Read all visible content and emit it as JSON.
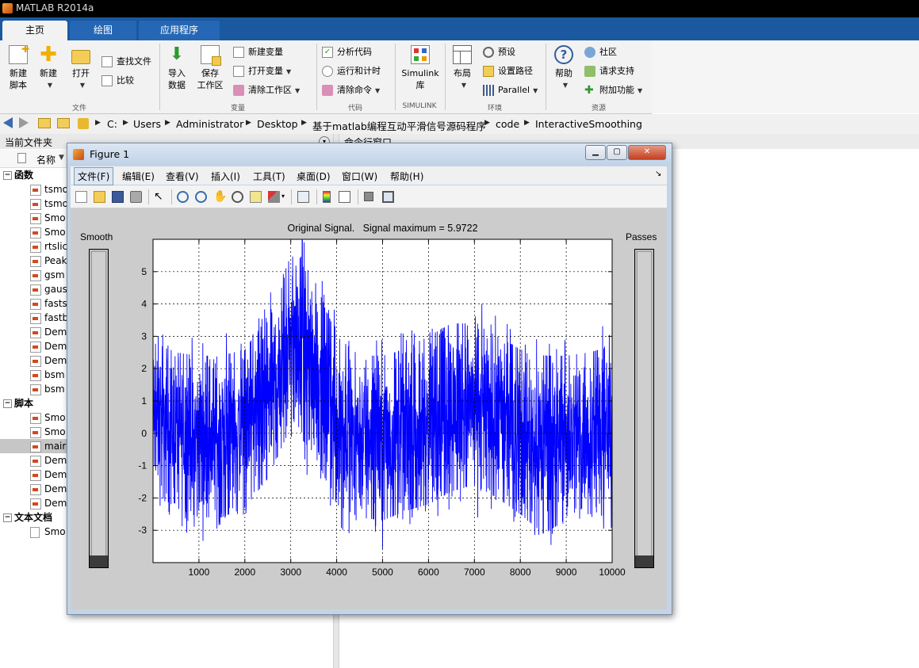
{
  "app": {
    "title": "MATLAB R2014a"
  },
  "tabs": [
    "主页",
    "绘图",
    "应用程序"
  ],
  "ribbon": {
    "groups": {
      "file": "文件",
      "variable": "变量",
      "code": "代码",
      "simulink": "SIMULINK",
      "environment": "环境",
      "resources": "资源"
    },
    "new_script": [
      "新建",
      "脚本"
    ],
    "new": "新建",
    "open": "打开",
    "find_files": "查找文件",
    "compare": "比较",
    "import_data": [
      "导入",
      "数据"
    ],
    "save_workspace": [
      "保存",
      "工作区"
    ],
    "new_variable": "新建变量",
    "open_variable": "打开变量",
    "clear_workspace": "清除工作区",
    "analyze_code": "分析代码",
    "run_and_time": "运行和计时",
    "clear_commands": "清除命令",
    "simulink": [
      "Simulink",
      "库"
    ],
    "layout": "布局",
    "preferences": "预设",
    "set_path": "设置路径",
    "parallel": "Parallel",
    "help": "帮助",
    "community": "社区",
    "request_support": "请求支持",
    "addons": "附加功能"
  },
  "address": {
    "path": [
      "C:",
      "Users",
      "Administrator",
      "Desktop",
      "基于matlab编程互动平滑信号源码程序",
      "code",
      "InteractiveSmoothing"
    ]
  },
  "left_panel": {
    "title": "当前文件夹",
    "name_col": "名称",
    "sections": [
      {
        "label": "函数",
        "items": [
          "tsmo",
          "tsmo",
          "Smo",
          "Smo",
          "rtslic",
          "Peak",
          "gsm",
          "gaus",
          "fasts",
          "fastb",
          "Dem",
          "Dem",
          "Dem",
          "bsm",
          "bsm"
        ]
      },
      {
        "label": "脚本",
        "items": [
          "Smo",
          "Smo",
          "mair",
          "Dem",
          "Dem",
          "Dem",
          "Dem"
        ]
      },
      {
        "label": "文本文档",
        "items": [
          "Smo"
        ]
      }
    ]
  },
  "cmd": {
    "title": "命令行窗口"
  },
  "figure": {
    "title": "Figure 1",
    "menus": [
      "文件(F)",
      "编辑(E)",
      "查看(V)",
      "插入(I)",
      "工具(T)",
      "桌面(D)",
      "窗口(W)",
      "帮助(H)"
    ],
    "smooth_label": "Smooth",
    "passes_label": "Passes",
    "smooth_level": 0,
    "passes_level": 0
  },
  "chart_data": {
    "type": "line",
    "title": "Original Signal.   Signal maximum = 5.9722",
    "xlabel": "",
    "ylabel": "",
    "xlim": [
      0,
      10000
    ],
    "ylim": [
      -4,
      6
    ],
    "xticks": [
      "1000",
      "2000",
      "3000",
      "4000",
      "5000",
      "6000",
      "7000",
      "8000",
      "9000",
      "10000"
    ],
    "yticks": [
      "5",
      "4",
      "3",
      "2",
      "1",
      "0",
      "-1",
      "-2",
      "-3"
    ],
    "grid": true,
    "color": "#0000ff",
    "series": [
      {
        "x": [
          0,
          500,
          1000,
          1500,
          2000,
          2500,
          3000,
          3500,
          4000,
          4500,
          5000,
          5500,
          6000,
          6500,
          7000,
          7500,
          8000,
          8500,
          9000,
          9500,
          10000
        ],
        "envelope_upper": [
          2.8,
          2.5,
          2.4,
          2.4,
          2.6,
          3.6,
          5.5,
          4.8,
          3.0,
          2.4,
          2.4,
          2.6,
          3.0,
          3.4,
          3.4,
          3.0,
          2.6,
          2.4,
          2.4,
          2.5,
          2.7
        ],
        "envelope_lower": [
          -1.8,
          -2.3,
          -2.6,
          -2.6,
          -2.3,
          -1.4,
          0.2,
          -0.6,
          -2.2,
          -2.6,
          -2.7,
          -2.4,
          -2.2,
          -1.8,
          -1.6,
          -2.0,
          -2.5,
          -3.1,
          -2.7,
          -2.6,
          -2.5
        ],
        "peak": {
          "x": 3250,
          "y": 5.9722
        }
      }
    ]
  }
}
